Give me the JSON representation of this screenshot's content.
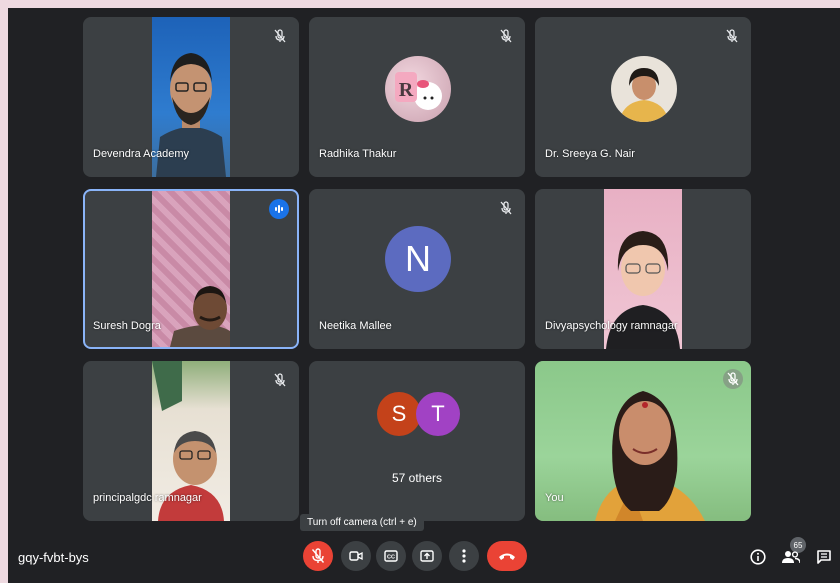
{
  "meeting": {
    "code": "gqy-fvbt-bys",
    "participant_count": "65"
  },
  "participants": [
    {
      "name": "Devendra Academy",
      "muted": true
    },
    {
      "name": "Radhika Thakur",
      "muted": true,
      "avatar_letter": "R"
    },
    {
      "name": "Dr. Sreeya G. Nair",
      "muted": true
    },
    {
      "name": "Suresh Dogra",
      "speaking": true
    },
    {
      "name": "Neetika Mallee",
      "muted": true,
      "avatar_letter": "N"
    },
    {
      "name": "Divyapsychology ramnagar"
    },
    {
      "name": "principalgdc ramnagar",
      "muted": true
    },
    {
      "name": "57 others",
      "avatars": [
        "S",
        "T"
      ]
    },
    {
      "name": "You",
      "muted": true
    }
  ],
  "controls": {
    "tooltip": "Turn off camera (ctrl + e)"
  },
  "colors": {
    "active_border": "#8ab4f8",
    "danger": "#ea4335",
    "tile_bg": "#3c4043",
    "speaking": "#1a73e8"
  }
}
